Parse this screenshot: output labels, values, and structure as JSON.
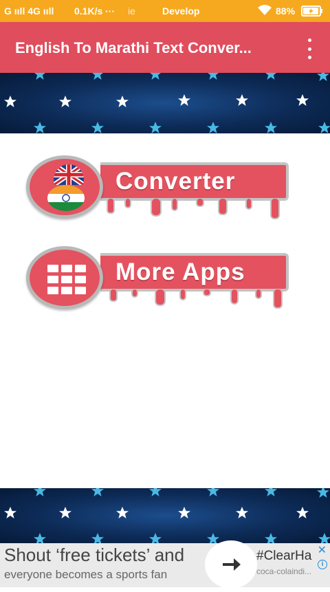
{
  "status_bar": {
    "carrier": "G ııll 4G ııll",
    "speed": "0.1K/s",
    "dots": "···",
    "notif": "ie",
    "center": "Develop",
    "battery": "88%"
  },
  "app_bar": {
    "title": "English To Marathi Text Conver...",
    "overflow_icon": "more-vert-icon"
  },
  "menu": {
    "converter_label": "Converter",
    "more_apps_label": "More Apps"
  },
  "ad": {
    "headline": "Shout ‘free tickets’ and",
    "subline": "everyone becomes a sports fan",
    "hashtag": "#ClearHa",
    "advertiser": "coca-colaindi...",
    "close": "✕",
    "info": "i"
  },
  "colors": {
    "status_bar": "#f6a91e",
    "app_bar": "#e04d5d",
    "button": "#e4525f",
    "star_bg": "#0d2b57"
  }
}
